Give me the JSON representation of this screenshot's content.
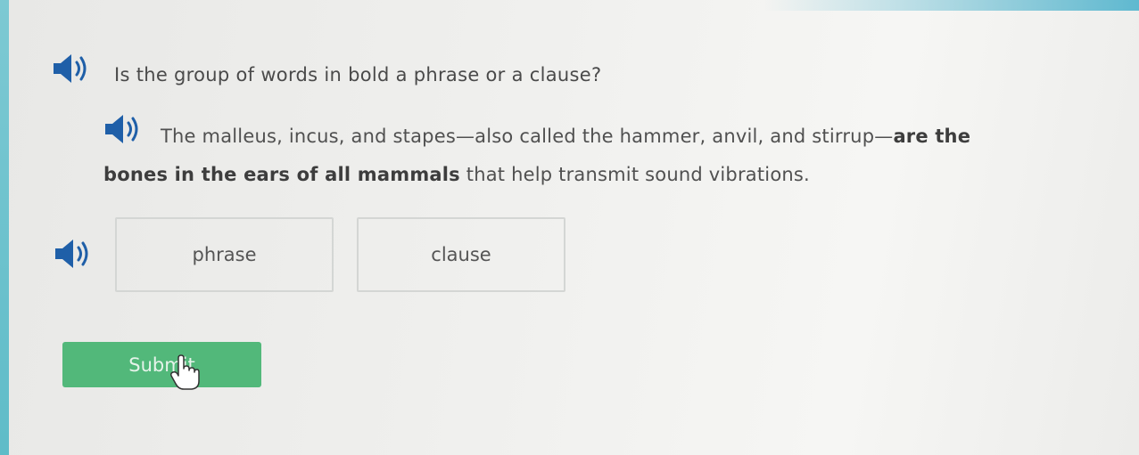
{
  "question": {
    "text": "Is the group of words in bold a phrase or a clause?",
    "audio_icon": "speaker-icon"
  },
  "passage": {
    "audio_icon": "speaker-icon",
    "line1_normal": "The malleus, incus, and stapes—also called the hammer, anvil, and stirrup—",
    "line1_bold": "are the",
    "line2_bold": "bones in the ears of all mammals",
    "line2_normal": " that help transmit sound vibrations."
  },
  "options": {
    "audio_icon": "speaker-icon",
    "items": [
      {
        "label": "phrase"
      },
      {
        "label": "clause"
      }
    ]
  },
  "submit": {
    "label": "Submit"
  },
  "colors": {
    "accent_teal": "#5fbcc8",
    "submit_green": "#52b87a",
    "speaker_blue": "#1f5fa8"
  }
}
